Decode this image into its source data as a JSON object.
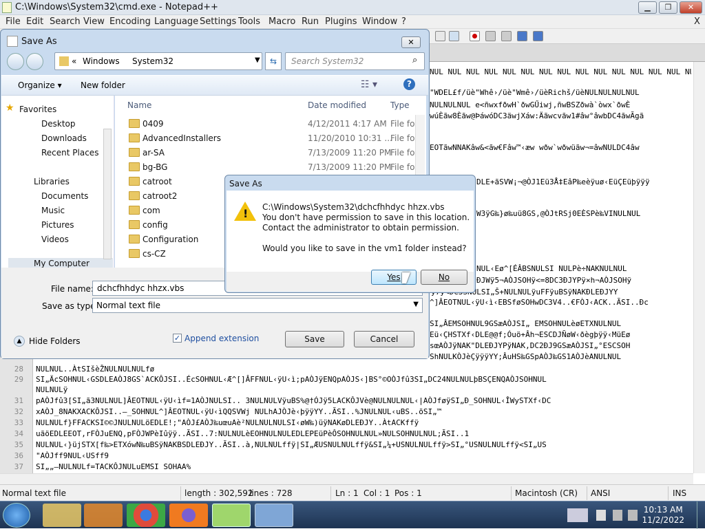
{
  "window": {
    "title": "C:\\Windows\\System32\\cmd.exe - Notepad++",
    "min": "▁",
    "max": "❐",
    "close": "✕"
  },
  "menu": [
    "File",
    "Edit",
    "Search",
    "View",
    "Encoding",
    "Language",
    "Settings",
    "Tools",
    "Macro",
    "Run",
    "Plugins",
    "Window",
    "?"
  ],
  "menu_close": "X",
  "editor": {
    "lines": [
      {
        "n": "28",
        "t": "NULNUL..ÀtSIšèŽNULNULNULfø"
      },
      {
        "n": "29",
        "t": "SI„ÄcSOHNUL‹GSDLEAÒJ8GS`ACKÔJSI..ÉcSOHNUL‹Æ^[]ÂFFNUL‹ÿU‹ì;pAÒJÿENQpAÒJS‹]BS°©OÒJfû3SI„DC24NULNULþBSÇENQAÒJSOHNUL"
      },
      {
        "n": "",
        "t": "NULNULÿ"
      },
      {
        "n": "31",
        "t": "pAÒJfû3[SI„ã3NULNUL]ÂEOTNUL‹ÿU‹ìf=1AÒJNULSI.. 3NULNULVÿuBS%@†ÓJÿ5LACKÔJVè@NULNULNUL‹|AÒJføÿSI„Ð_SOHNUL‹ÎWySTXf‹DC"
      },
      {
        "n": "32",
        "t": "xAÒJ_8NAKXACKÔJSI..–_SOHNUL^]ÂEOTNUL‹ÿU‹ìQQSVWj NULhAJÒJè‹þÿÿYY..ÃSI..%JNULNUL‹uBS..õSI„™"
      },
      {
        "n": "33",
        "t": "NULNULf}FFACKSI©©JNULNULöEDLE!;\"AÒJ£AÒJ‰uœuAè²NULNULNULSI‹øW‰)üÿNAKøDLEÐJY..ÀtACKffÿ"
      },
      {
        "n": "34",
        "t": "uãöEDLEEOT,rFÒJuENQ,pFÒJWPèIûÿÿ..ÃSI..7:NULNULèEOHNULNULEDLEPEüPèÔSOHNULNUL»NULSOHNULNUL;ÃSI..1"
      },
      {
        "n": "35",
        "t": "NULNUL‹}üjSTX[f‰>ETXówN‰uBSÿNAKBSDLEÐJY..ÃSI..à,NULNULffÿ|SI„ÆUSNULNULffÿ&SI„¼+USNULNULffÿ>SI„°USNULNULffÿ<SI„US"
      },
      {
        "n": "36",
        "t": "\"AÒJff9NUL‹USff9"
      },
      {
        "n": "37",
        "t": "SI„„–NULNULf=TACKÔJNULuEMSI SOHAA%"
      }
    ],
    "right_lines": [
      "NUL NUL NUL NUL NUL NUL NUL NUL NUL NUL NUL NUL NUL NUL NUL",
      "\"WDEL£f/üè\"Whê›/üè\"Wmê›/üèRichš/üèNULNULNULNUL",
      "NULNULNUL e<ñwxfðwH`ðwGŰiwj,ñwBSZðwà`òwx`ðwÈ",
      "wúÈãw8Èãw@ÞáwóDC3äwjXáw:Äãwcvãw1#âw°âwbDC4ãwÃgã",
      "EOTãwNNAKâw&<ãw€Fâw™‹æw wðw`wðwüãw¬=âwNULDC4âw",
      "DLE+ãSVW¡¬@ÒJ1Eü3Å‡EâP‰eèÿuø‹EüÇEüþÿÿÿ",
      "W3ÿG‰}ø‰uü8GS,@ÒJtRSj0EÈSPè‰VINULNUL",
      "NUL‹Eø^[ÉÂBSNULSI NULPè÷NAKNULNUL",
      "ÐJWÿ5¬AÒJSOHÿ<=8DC3ÐJYPÿ×h¬AÒJSOHÿ",
      "ÿ7ÿ<DC3SNULSI„Š+NULNULÿuFFÿuBSÿNAKÐLEÐJYY",
      "^]ÂEOTNUL‹ÿU‹ì‹EBSføSOHwDC3V4..€FÒJ‹ACK..ÃSI..Ðc",
      "SI„ÂEMSOHNUL9GSæAÒJSI„ EMSOHNULèøETXNULNUL",
      "Eü‹ÇHSTXf‹DLE@@f;Óuö+Âh¬ESCDJÑøW‹ðègþÿÿ‹MüEø",
      "sœAÒJÿNAK\"DLEÐJYPÿNAK,DC2ÐJ9GSæAÒJSI„°ESCSOH",
      "ShNULKÒJèÇÿÿÿYY;ÂuHS‰GSpAÒJ‰GS1AÒJèANULNUL"
    ]
  },
  "status": {
    "type": "Normal text file",
    "length": "length : 302,592",
    "lines": "lines : 728",
    "ln": "Ln : 1",
    "col": "Col : 1",
    "pos": "Pos : 1",
    "eol": "Macintosh (CR)",
    "enc": "ANSI",
    "mode": "INS"
  },
  "taskbar": {
    "time": "10:13 AM",
    "date": "11/2/2022"
  },
  "saveas": {
    "title": "Save As",
    "close": "✕",
    "path": [
      "«",
      "Windows",
      "System32"
    ],
    "search_placeholder": "Search System32",
    "organize": "Organize ▾",
    "new_folder": "New folder",
    "columns": [
      "Name",
      "Date modified",
      "Type"
    ],
    "nav": {
      "favorites": "Favorites",
      "desktop": "Desktop",
      "downloads": "Downloads",
      "recent": "Recent Places",
      "libraries": "Libraries",
      "documents": "Documents",
      "music": "Music",
      "pictures": "Pictures",
      "videos": "Videos",
      "computer": "My Computer"
    },
    "files": [
      {
        "name": "0409",
        "date": "4/12/2011 4:17 AM",
        "type": "File fol"
      },
      {
        "name": "AdvancedInstallers",
        "date": "11/20/2010 10:31 ...",
        "type": "File fol"
      },
      {
        "name": "ar-SA",
        "date": "7/13/2009 11:20 PM",
        "type": "File fol"
      },
      {
        "name": "bg-BG",
        "date": "7/13/2009 11:20 PM",
        "type": "File fol"
      },
      {
        "name": "catroot",
        "date": "",
        "type": ""
      },
      {
        "name": "catroot2",
        "date": "",
        "type": ""
      },
      {
        "name": "com",
        "date": "",
        "type": ""
      },
      {
        "name": "config",
        "date": "",
        "type": ""
      },
      {
        "name": "Configuration",
        "date": "",
        "type": ""
      },
      {
        "name": "cs-CZ",
        "date": "",
        "type": ""
      }
    ],
    "filename_label": "File name:",
    "filename_value": "dchcfhhdyc hhzx.vbs",
    "savetype_label": "Save as type:",
    "savetype_value": "Normal text file",
    "hide_folders": "Hide Folders",
    "append_ext": "Append extension",
    "save": "Save",
    "cancel": "Cancel"
  },
  "confirm": {
    "title": "Save As",
    "line1": "C:\\Windows\\System32\\dchcfhhdyc hhzx.vbs",
    "line2": "You don't have permission to save in this location.",
    "line3": "Contact the administrator to obtain permission.",
    "line4": "Would you like to save in the vm1 folder instead?",
    "yes": "Yes",
    "no": "No"
  }
}
